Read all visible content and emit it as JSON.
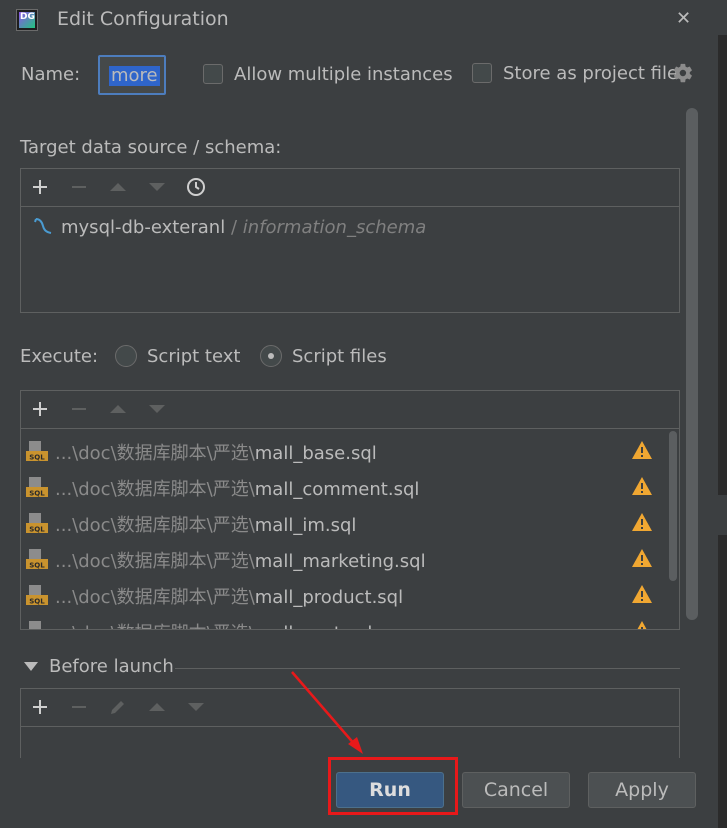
{
  "window": {
    "title": "Edit Configuration",
    "logo_text": "DG"
  },
  "name": {
    "label": "Name:",
    "value": "more"
  },
  "options": {
    "allow_multiple": "Allow multiple instances",
    "store_as_project": "Store as project file"
  },
  "target": {
    "label": "Target data source / schema:",
    "datasource": "mysql-db-exteranl",
    "separator": "/",
    "schema": "information_schema"
  },
  "execute": {
    "label": "Execute:",
    "script_text": "Script text",
    "script_files": "Script files",
    "selected": "Script files"
  },
  "files": [
    {
      "dir": "...\\doc\\数据库脚本\\严选\\",
      "name": "mall_base.sql"
    },
    {
      "dir": "...\\doc\\数据库脚本\\严选\\",
      "name": "mall_comment.sql"
    },
    {
      "dir": "...\\doc\\数据库脚本\\严选\\",
      "name": "mall_im.sql"
    },
    {
      "dir": "...\\doc\\数据库脚本\\严选\\",
      "name": "mall_marketing.sql"
    },
    {
      "dir": "...\\doc\\数据库脚本\\严选\\",
      "name": "mall_product.sql"
    },
    {
      "dir": "...\\doc\\数据库脚本\\严选\\",
      "name": "mall_seat.sql"
    }
  ],
  "before_launch": {
    "label": "Before launch"
  },
  "buttons": {
    "run": "Run",
    "cancel": "Cancel",
    "apply": "Apply"
  },
  "colors": {
    "accent": "#365880",
    "highlight": "#e8191a",
    "warning": "#f0a732"
  }
}
